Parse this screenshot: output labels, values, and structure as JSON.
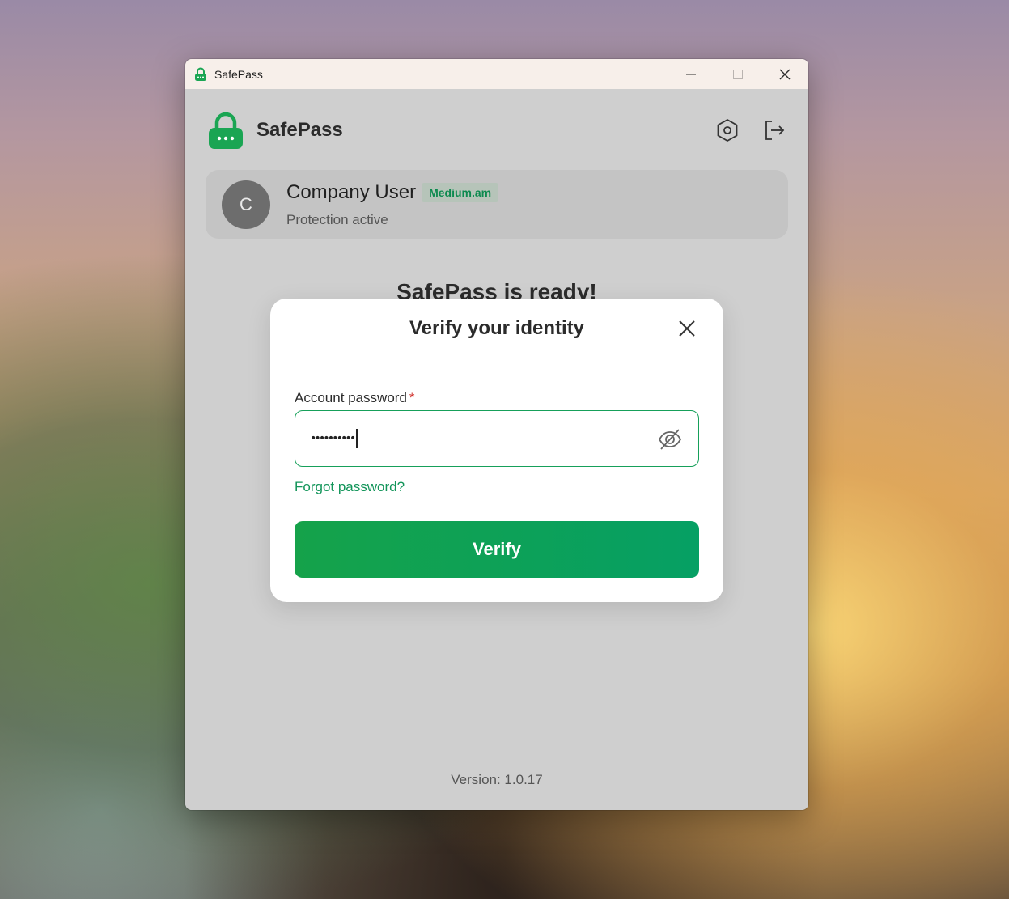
{
  "window": {
    "title": "SafePass",
    "controls": [
      "minimize-icon",
      "maximize-icon",
      "close-icon"
    ]
  },
  "header": {
    "brand": "SafePass",
    "logo_icon": "padlock-icon",
    "actions": [
      {
        "name": "settings",
        "icon": "hexagon-gear-icon"
      },
      {
        "name": "logout",
        "icon": "logout-icon"
      }
    ]
  },
  "user": {
    "initial": "C",
    "name": "Company User",
    "badge": "Medium.am",
    "status": "Protection active"
  },
  "main": {
    "ready_text": "SafePass is ready!"
  },
  "footer": {
    "version": "Version: 1.0.17"
  },
  "modal": {
    "title": "Verify your identity",
    "password_label": "Account password",
    "required_mark": "*",
    "password_value": "••••••••••",
    "toggle_icon": "eye-off-icon",
    "forgot_link": "Forgot password?",
    "submit_label": "Verify"
  },
  "colors": {
    "accent": "#16a05a",
    "link": "#13955a",
    "badge_text": "#0d8a4f",
    "required": "#d0322d"
  }
}
